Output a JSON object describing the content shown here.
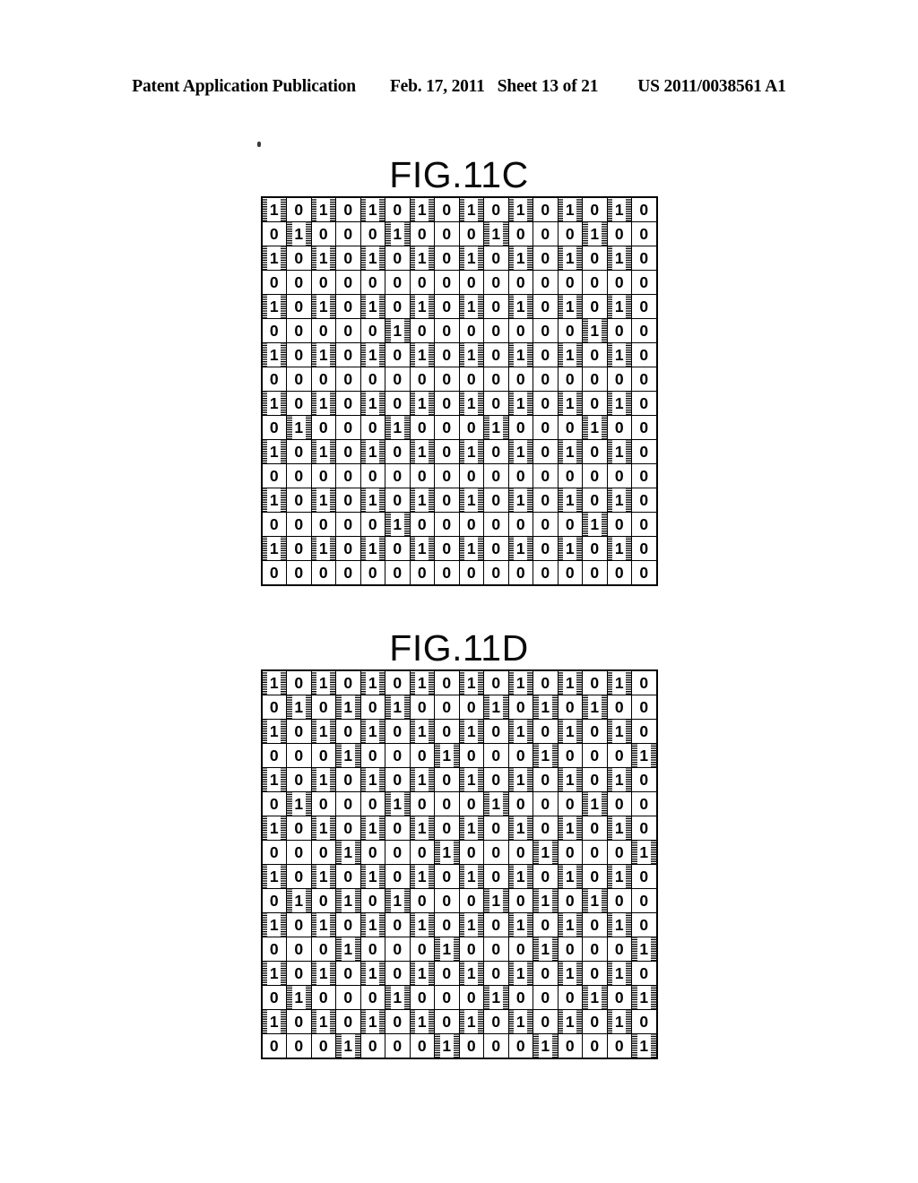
{
  "header": {
    "publication": "Patent Application Publication",
    "date": "Feb. 17, 2011",
    "sheet": "Sheet 13 of 21",
    "patent_number": "US 2011/0038561 A1"
  },
  "figures": [
    {
      "id": "fig-11c",
      "title": "FIG.11C",
      "columns": 16,
      "rows": 16,
      "matrix": [
        [
          1,
          0,
          1,
          0,
          1,
          0,
          1,
          0,
          1,
          0,
          1,
          0,
          1,
          0,
          1,
          0
        ],
        [
          0,
          1,
          0,
          0,
          0,
          1,
          0,
          0,
          0,
          1,
          0,
          0,
          0,
          1,
          0,
          0
        ],
        [
          1,
          0,
          1,
          0,
          1,
          0,
          1,
          0,
          1,
          0,
          1,
          0,
          1,
          0,
          1,
          0
        ],
        [
          0,
          0,
          0,
          0,
          0,
          0,
          0,
          0,
          0,
          0,
          0,
          0,
          0,
          0,
          0,
          0
        ],
        [
          1,
          0,
          1,
          0,
          1,
          0,
          1,
          0,
          1,
          0,
          1,
          0,
          1,
          0,
          1,
          0
        ],
        [
          0,
          0,
          0,
          0,
          0,
          1,
          0,
          0,
          0,
          0,
          0,
          0,
          0,
          1,
          0,
          0
        ],
        [
          1,
          0,
          1,
          0,
          1,
          0,
          1,
          0,
          1,
          0,
          1,
          0,
          1,
          0,
          1,
          0
        ],
        [
          0,
          0,
          0,
          0,
          0,
          0,
          0,
          0,
          0,
          0,
          0,
          0,
          0,
          0,
          0,
          0
        ],
        [
          1,
          0,
          1,
          0,
          1,
          0,
          1,
          0,
          1,
          0,
          1,
          0,
          1,
          0,
          1,
          0
        ],
        [
          0,
          1,
          0,
          0,
          0,
          1,
          0,
          0,
          0,
          1,
          0,
          0,
          0,
          1,
          0,
          0
        ],
        [
          1,
          0,
          1,
          0,
          1,
          0,
          1,
          0,
          1,
          0,
          1,
          0,
          1,
          0,
          1,
          0
        ],
        [
          0,
          0,
          0,
          0,
          0,
          0,
          0,
          0,
          0,
          0,
          0,
          0,
          0,
          0,
          0,
          0
        ],
        [
          1,
          0,
          1,
          0,
          1,
          0,
          1,
          0,
          1,
          0,
          1,
          0,
          1,
          0,
          1,
          0
        ],
        [
          0,
          0,
          0,
          0,
          0,
          1,
          0,
          0,
          0,
          0,
          0,
          0,
          0,
          1,
          0,
          0
        ],
        [
          1,
          0,
          1,
          0,
          1,
          0,
          1,
          0,
          1,
          0,
          1,
          0,
          1,
          0,
          1,
          0
        ],
        [
          0,
          0,
          0,
          0,
          0,
          0,
          0,
          0,
          0,
          0,
          0,
          0,
          0,
          0,
          0,
          0
        ]
      ]
    },
    {
      "id": "fig-11d",
      "title": "FIG.11D",
      "columns": 16,
      "rows": 16,
      "matrix": [
        [
          1,
          0,
          1,
          0,
          1,
          0,
          1,
          0,
          1,
          0,
          1,
          0,
          1,
          0,
          1,
          0
        ],
        [
          0,
          1,
          0,
          1,
          0,
          1,
          0,
          0,
          0,
          1,
          0,
          1,
          0,
          1,
          0,
          0
        ],
        [
          1,
          0,
          1,
          0,
          1,
          0,
          1,
          0,
          1,
          0,
          1,
          0,
          1,
          0,
          1,
          0
        ],
        [
          0,
          0,
          0,
          1,
          0,
          0,
          0,
          1,
          0,
          0,
          0,
          1,
          0,
          0,
          0,
          1
        ],
        [
          1,
          0,
          1,
          0,
          1,
          0,
          1,
          0,
          1,
          0,
          1,
          0,
          1,
          0,
          1,
          0
        ],
        [
          0,
          1,
          0,
          0,
          0,
          1,
          0,
          0,
          0,
          1,
          0,
          0,
          0,
          1,
          0,
          0
        ],
        [
          1,
          0,
          1,
          0,
          1,
          0,
          1,
          0,
          1,
          0,
          1,
          0,
          1,
          0,
          1,
          0
        ],
        [
          0,
          0,
          0,
          1,
          0,
          0,
          0,
          1,
          0,
          0,
          0,
          1,
          0,
          0,
          0,
          1
        ],
        [
          1,
          0,
          1,
          0,
          1,
          0,
          1,
          0,
          1,
          0,
          1,
          0,
          1,
          0,
          1,
          0
        ],
        [
          0,
          1,
          0,
          1,
          0,
          1,
          0,
          0,
          0,
          1,
          0,
          1,
          0,
          1,
          0,
          0
        ],
        [
          1,
          0,
          1,
          0,
          1,
          0,
          1,
          0,
          1,
          0,
          1,
          0,
          1,
          0,
          1,
          0
        ],
        [
          0,
          0,
          0,
          1,
          0,
          0,
          0,
          1,
          0,
          0,
          0,
          1,
          0,
          0,
          0,
          1
        ],
        [
          1,
          0,
          1,
          0,
          1,
          0,
          1,
          0,
          1,
          0,
          1,
          0,
          1,
          0,
          1,
          0
        ],
        [
          0,
          1,
          0,
          0,
          0,
          1,
          0,
          0,
          0,
          1,
          0,
          0,
          0,
          1,
          0,
          1
        ],
        [
          1,
          0,
          1,
          0,
          1,
          0,
          1,
          0,
          1,
          0,
          1,
          0,
          1,
          0,
          1,
          0
        ],
        [
          0,
          0,
          0,
          1,
          0,
          0,
          0,
          1,
          0,
          0,
          0,
          1,
          0,
          0,
          0,
          1
        ]
      ]
    }
  ],
  "cell_labels": {
    "on": "1",
    "off": "0"
  }
}
